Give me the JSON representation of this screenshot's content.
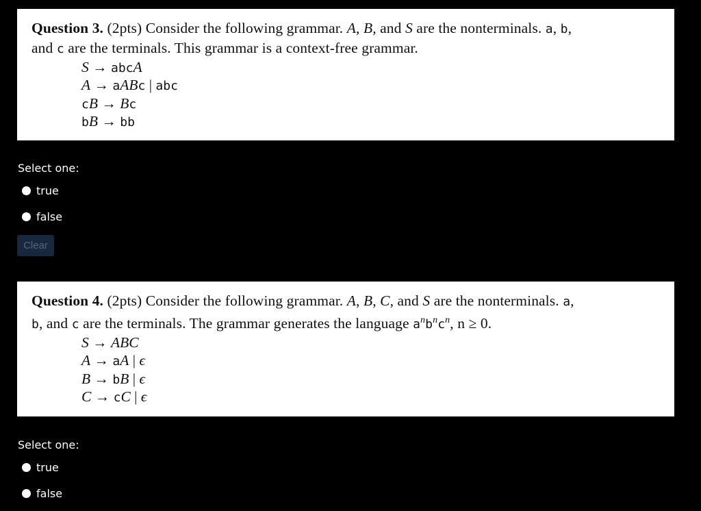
{
  "questions": [
    {
      "id": "q3",
      "title": "Question 3.",
      "points": "(2pts)",
      "text_parts": {
        "p1": " Consider the following grammar. ",
        "A": "A",
        "sep1": ", ",
        "B": "B",
        "sep2": ", and ",
        "S": "S",
        "p2": " are the nonterminals. ",
        "ta": "a",
        "sep3": ", ",
        "tb": "b",
        "sep4": ",",
        "p3": "and ",
        "tc": "c",
        "p4": " are the terminals. This grammar is a context-free grammar."
      },
      "rules": [
        "S → abcA",
        "A → aABc | abc",
        "cB → Bc",
        "bB → bb"
      ],
      "select_label": "Select one:",
      "options": [
        "true",
        "false"
      ],
      "clear_label": "Clear"
    },
    {
      "id": "q4",
      "title": "Question 4.",
      "points": "(2pts)",
      "text_parts": {
        "p1": " Consider the following grammar. ",
        "A": "A",
        "sep1": ", ",
        "B": "B",
        "sep2": ", ",
        "C": "C",
        "sep3": ", and ",
        "S": "S",
        "p2": " are the nonterminals. ",
        "ta": "a",
        "sep4": ",",
        "tb": "b",
        "p3": ", and ",
        "tc": "c",
        "p4": " are the terminals. The grammar generates the language ",
        "lang_a": "a",
        "lang_b": "b",
        "lang_c": "c",
        "exp": "n",
        "cond": ", n ≥ 0."
      },
      "rules": [
        "S → ABC",
        "A → aA | ϵ",
        "B → bB | ϵ",
        "C → cC | ϵ"
      ],
      "select_label": "Select one:",
      "options": [
        "true",
        "false"
      ]
    }
  ]
}
